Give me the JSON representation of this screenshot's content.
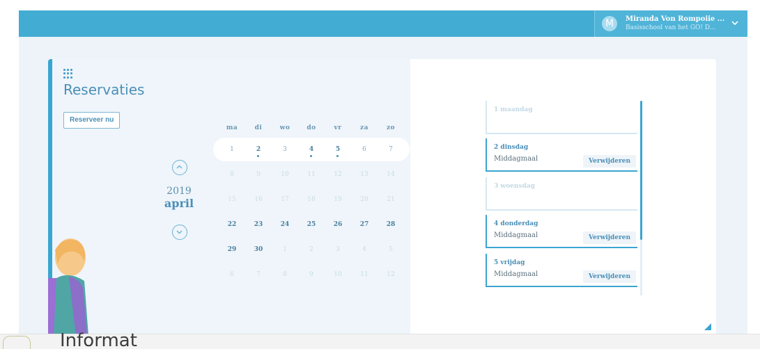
{
  "header": {
    "avatar_initial": "M",
    "user_name": "Miranda Von Rompoiie ...",
    "school": "Basisschool van het GO! D..."
  },
  "page": {
    "title": "Reservaties",
    "reserve_button": "Reserveer nu"
  },
  "calendar": {
    "year": "2019",
    "month": "april",
    "weekdays": [
      "ma",
      "di",
      "wo",
      "do",
      "vr",
      "za",
      "zo"
    ],
    "weeks": [
      [
        "1",
        "2",
        "3",
        "4",
        "5",
        "6",
        "7"
      ],
      [
        "8",
        "9",
        "10",
        "11",
        "12",
        "13",
        "14"
      ],
      [
        "15",
        "16",
        "17",
        "18",
        "19",
        "20",
        "21"
      ],
      [
        "22",
        "23",
        "24",
        "25",
        "26",
        "27",
        "28"
      ],
      [
        "29",
        "30",
        "1",
        "2",
        "3",
        "4",
        "5"
      ],
      [
        "6",
        "7",
        "8",
        "9",
        "10",
        "11",
        "12"
      ]
    ],
    "selected_week_index": 0,
    "reserved_days": [
      "2",
      "4",
      "5"
    ]
  },
  "day_list": [
    {
      "label": "1 maandag",
      "meal": "",
      "action": "",
      "active": false
    },
    {
      "label": "2 dinsdag",
      "meal": "Middagmaal",
      "action": "Verwijderen",
      "active": true
    },
    {
      "label": "3 woensdag",
      "meal": "",
      "action": "",
      "active": false
    },
    {
      "label": "4 donderdag",
      "meal": "Middagmaal",
      "action": "Verwijderen",
      "active": true
    },
    {
      "label": "5 vrijdag",
      "meal": "Middagmaal",
      "action": "Verwijderen",
      "active": true
    }
  ],
  "watermark": {
    "text": "Informat"
  },
  "colors": {
    "accent": "#3aa5d1",
    "header": "#43acd3",
    "panel_bg": "#eff5fa"
  }
}
